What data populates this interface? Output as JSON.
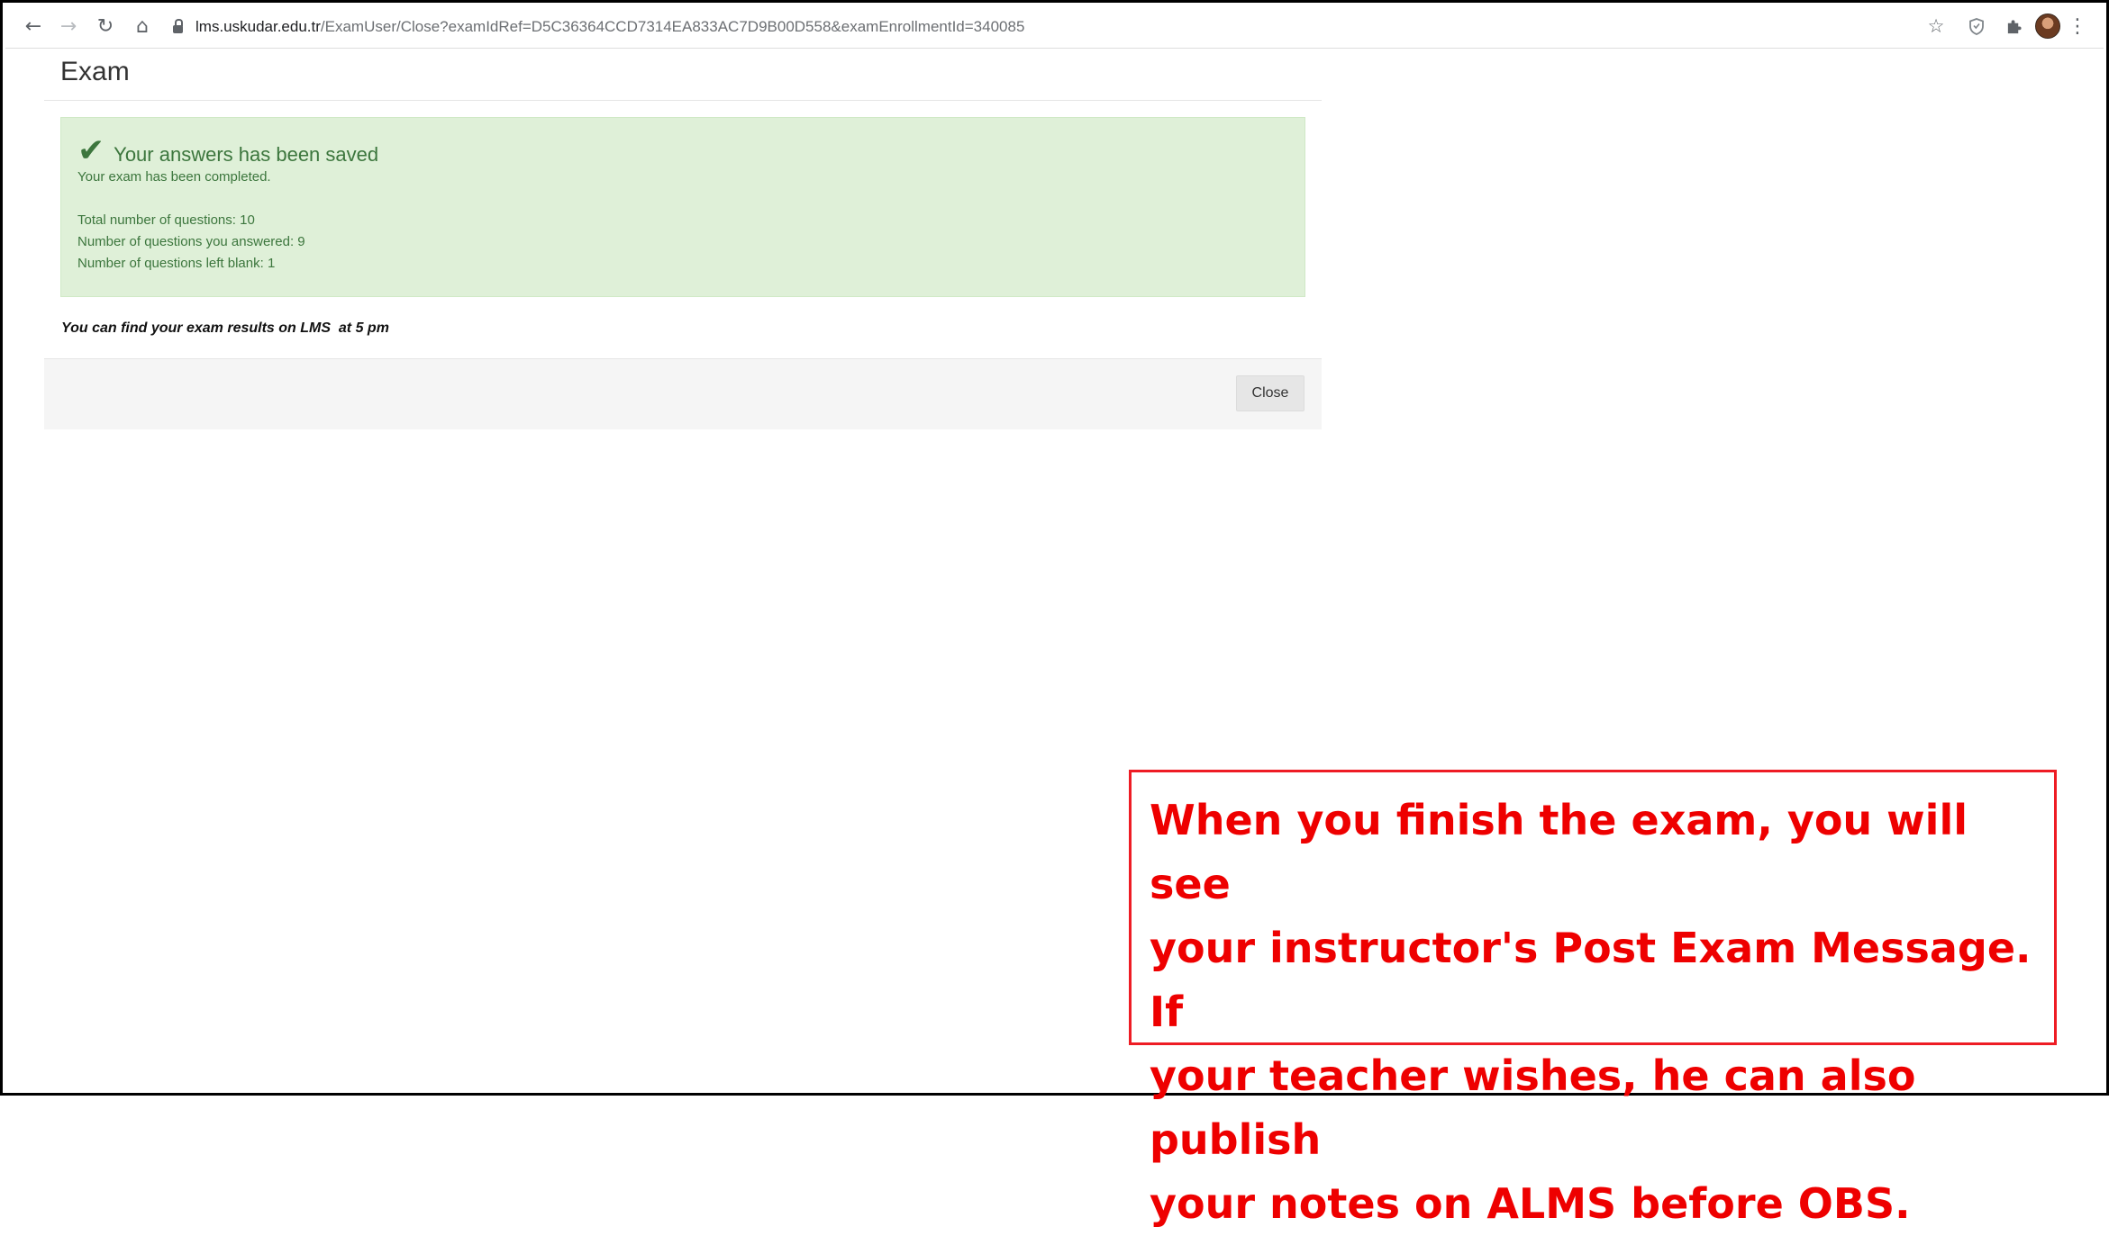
{
  "browser": {
    "url_host": "lms.uskudar.edu.tr",
    "url_path": "/ExamUser/Close?examIdRef=D5C36364CCD7314EA833AC7D9B00D558&examEnrollmentId=340085",
    "icons": [
      "back-arrow-icon",
      "forward-arrow-icon",
      "reload-icon",
      "home-icon",
      "lock-icon",
      "star-icon",
      "shield-extension-icon",
      "puzzle-extensions-icon",
      "profile-avatar",
      "kebab-menu-icon"
    ]
  },
  "page": {
    "title": "Exam"
  },
  "alert": {
    "title": "Your answers has been saved",
    "completed": "Your exam has been completed.",
    "total_questions": "Total number of questions: 10",
    "answered": "Number of questions you answered: 9",
    "blank": "Number of questions left blank: 1",
    "color": "#3c763d",
    "background": "#dff0d8"
  },
  "results_note": "You can find your exam results on LMS  at 5 pm",
  "footer": {
    "close_label": "Close"
  },
  "callout": {
    "lines": [
      "When you finish the exam, you will see",
      "your instructor's Post Exam Message. If",
      "your teacher wishes, he can also publish",
      "your notes on ALMS before OBS."
    ],
    "color": "#ee0000"
  }
}
